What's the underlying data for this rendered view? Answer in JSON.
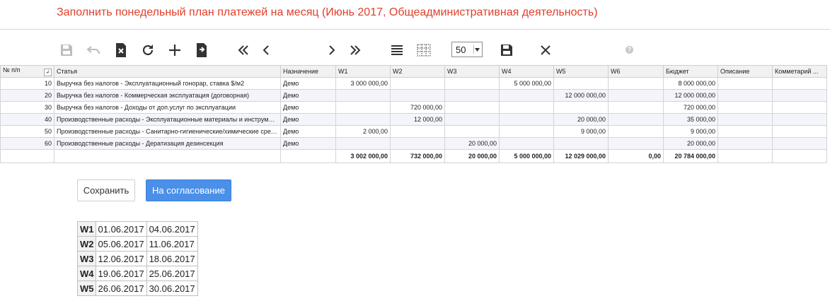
{
  "title": "Заполнить понедельный план платежей на месяц (Июнь 2017, Общеадминистративная деятельность)",
  "toolbar": {
    "page_size": "50",
    "icons": [
      "save-icon",
      "undo-icon",
      "delete-icon",
      "refresh-icon",
      "add-icon",
      "export-icon",
      "first-page-icon",
      "prev-page-icon",
      "next-page-icon",
      "last-page-icon",
      "rows-icon",
      "grid-icon",
      "save-view-icon",
      "close-icon",
      "help-icon"
    ],
    "help": "?"
  },
  "grid": {
    "columns": [
      "№ п/п",
      "Статья",
      "Назначение",
      "W1",
      "W2",
      "W3",
      "W4",
      "W5",
      "W6",
      "Бюджет",
      "Описание",
      "Комметарий ..."
    ],
    "rows": [
      [
        "10",
        "Выручка без налогов - Эксплуатационный гонорар, ставка $/м2",
        "Демо",
        "3 000 000,00",
        "",
        "",
        "5 000 000,00",
        "",
        "",
        "8 000 000,00",
        "",
        ""
      ],
      [
        "20",
        "Выручка без налогов - Коммерческая эксплуатация (договорная)",
        "Демо",
        "",
        "",
        "",
        "",
        "12 000 000,00",
        "",
        "12 000 000,00",
        "",
        ""
      ],
      [
        "30",
        "Выручка без налогов - Доходы от доп.услуг по эксплуатации",
        "Демо",
        "",
        "720 000,00",
        "",
        "",
        "",
        "",
        "720 000,00",
        "",
        ""
      ],
      [
        "40",
        "Производственные расходы - Эксплуатационные материалы и инструменты",
        "Демо",
        "",
        "12 000,00",
        "",
        "",
        "20 000,00",
        "",
        "35 000,00",
        "",
        ""
      ],
      [
        "50",
        "Производственные расходы - Санитарно-гигиенические/химические средства",
        "Демо",
        "2 000,00",
        "",
        "",
        "",
        "9 000,00",
        "",
        "9 000,00",
        "",
        ""
      ],
      [
        "60",
        "Производственные расходы - Дератизация дезинсекция",
        "Демо",
        "",
        "",
        "20 000,00",
        "",
        "",
        "",
        "20 000,00",
        "",
        ""
      ]
    ],
    "totals": [
      "",
      "",
      "",
      "3 002 000,00",
      "732 000,00",
      "20 000,00",
      "5 000 000,00",
      "12 029 000,00",
      "0,00",
      "20 784 000,00",
      "",
      ""
    ]
  },
  "buttons": {
    "save": "Сохранить",
    "approve": "На согласование"
  },
  "weeks": [
    [
      "W1",
      "01.06.2017",
      "04.06.2017"
    ],
    [
      "W2",
      "05.06.2017",
      "11.06.2017"
    ],
    [
      "W3",
      "12.06.2017",
      "18.06.2017"
    ],
    [
      "W4",
      "19.06.2017",
      "25.06.2017"
    ],
    [
      "W5",
      "26.06.2017",
      "30.06.2017"
    ]
  ],
  "colors": {
    "title": "#e0402a",
    "accent": "#4a90e8",
    "icon": "#333333",
    "icon_disabled": "#bdbdbd"
  }
}
